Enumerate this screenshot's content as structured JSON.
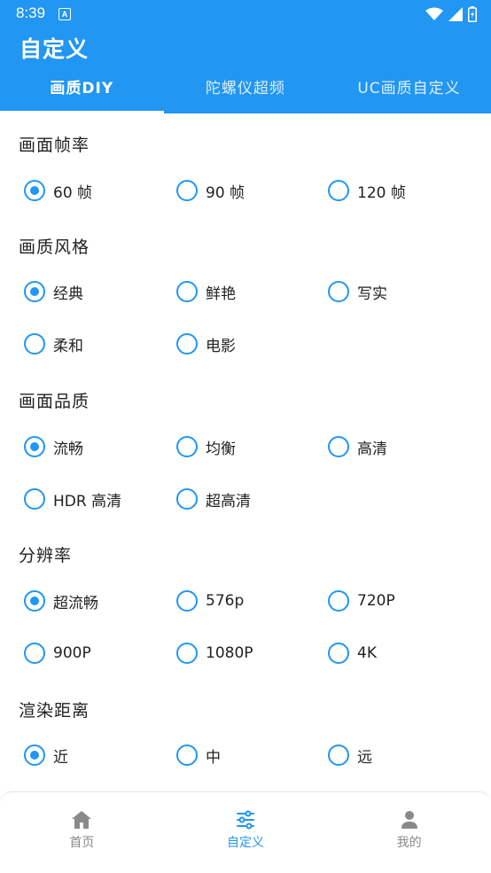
{
  "status_bar": {
    "time": "8:39",
    "notification_glyph": "A"
  },
  "app": {
    "title": "自定义"
  },
  "tabs": [
    {
      "label": "画质DIY",
      "active": true
    },
    {
      "label": "陀螺仪超频",
      "active": false
    },
    {
      "label": "UC画质自定义",
      "active": false
    }
  ],
  "sections": [
    {
      "title": "画面帧率",
      "options": [
        "60 帧",
        "90 帧",
        "120 帧"
      ],
      "selected": "60 帧"
    },
    {
      "title": "画质风格",
      "options": [
        "经典",
        "鲜艳",
        "写实",
        "柔和",
        "电影"
      ],
      "selected": "经典"
    },
    {
      "title": "画面品质",
      "options": [
        "流畅",
        "均衡",
        "高清",
        "HDR 高清",
        "超高清"
      ],
      "selected": "流畅"
    },
    {
      "title": "分辨率",
      "options": [
        "超流畅",
        "576p",
        "720P",
        "900P",
        "1080P",
        "4K"
      ],
      "selected": "超流畅"
    },
    {
      "title": "渲染距离",
      "options": [
        "近",
        "中",
        "远"
      ],
      "selected": "近"
    }
  ],
  "bottom_nav": [
    {
      "label": "首页",
      "icon": "home-icon",
      "active": false
    },
    {
      "label": "自定义",
      "icon": "sliders-icon",
      "active": true
    },
    {
      "label": "我的",
      "icon": "person-icon",
      "active": false
    }
  ],
  "colors": {
    "accent": "#2196f3",
    "header_bg": "#2196f3",
    "inactive_nav": "#8a8a8a"
  }
}
